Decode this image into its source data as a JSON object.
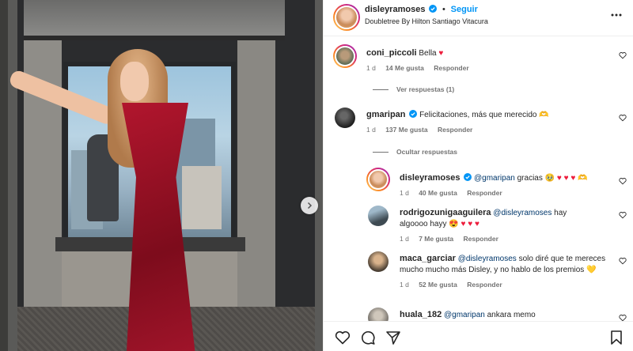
{
  "post": {
    "username": "disleyramoses",
    "follow_label": "Seguir",
    "dot": "•",
    "location": "Doubletree By Hilton Santiago Vitacura"
  },
  "comments": [
    {
      "user": "coni_piccoli",
      "text": "Bella",
      "emoji": "♥",
      "time": "1 d",
      "likes": "14 Me gusta",
      "reply": "Responder",
      "toggle": "Ver respuestas (1)"
    },
    {
      "user": "gmaripan",
      "text": "Felicitaciones, más que merecido",
      "emoji": "🫶",
      "time": "1 d",
      "likes": "137 Me gusta",
      "reply": "Responder",
      "toggle": "Ocultar respuestas"
    }
  ],
  "replies": [
    {
      "user": "disleyramoses",
      "mention": "@gmaripan",
      "text": "gracias",
      "emoji": "🥹 ♥ ♥ ♥ 🫶",
      "time": "1 d",
      "likes": "40 Me gusta",
      "reply": "Responder"
    },
    {
      "user": "rodrigozunigaaguilera",
      "mention": "@disleyramoses",
      "text": "hay algoooo hayy",
      "emoji": "😍 ♥ ♥ ♥",
      "time": "1 d",
      "likes": "7 Me gusta",
      "reply": "Responder"
    },
    {
      "user": "maca_garciar",
      "mention": "@disleyramoses",
      "text": "solo diré que te mereces mucho mucho más Disley, y no hablo de los premios",
      "emoji": "💛",
      "time": "1 d",
      "likes": "52 Me gusta",
      "reply": "Responder"
    },
    {
      "user": "huala_182",
      "mention": "@gmaripan",
      "text": "ankara memo",
      "emoji": "",
      "time": "",
      "likes": "",
      "reply": ""
    }
  ],
  "icons": {
    "like": "heart-icon",
    "comment": "comment-icon",
    "share": "send-icon",
    "save": "bookmark-icon",
    "more": "more-options-icon",
    "next": "chevron-right-icon",
    "verified": "verified-badge-icon"
  },
  "colors": {
    "link_blue": "#0095f6",
    "mention_blue": "#00376b",
    "muted": "#737373",
    "heart_red": "#ed1c3b",
    "verified_blue": "#0095f6"
  }
}
